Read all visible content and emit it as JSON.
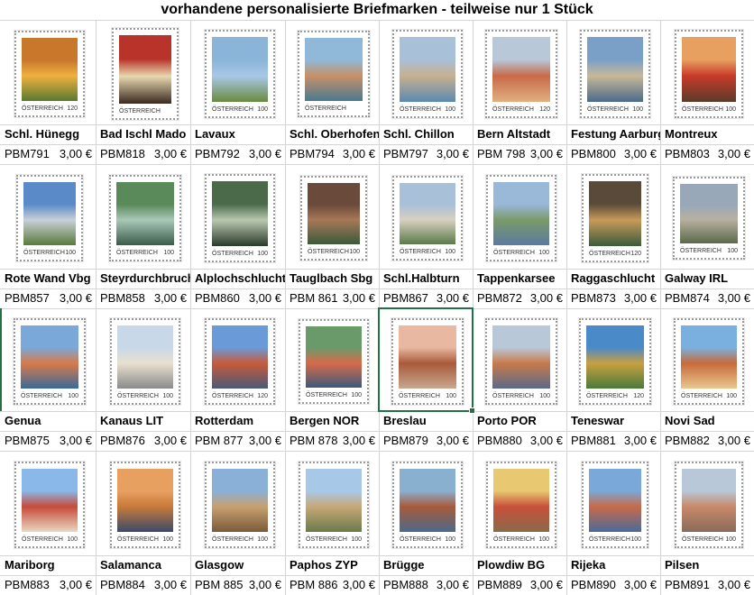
{
  "title": "vorhandene personalisierte Briefmarken -  teilweise nur 1 Stück",
  "stamp_country": "ÖSTERREICH",
  "currency": "€",
  "rows": [
    [
      {
        "name": "Schl. Hünegg",
        "code": "PBM791",
        "price": "3,00 €",
        "value": "120",
        "colors": [
          "#c8782a",
          "#f0b040",
          "#5a7a30"
        ]
      },
      {
        "name": "Bad Ischl Mado",
        "code": "PBM818",
        "price": "3,00 €",
        "value": "",
        "colors": [
          "#b8342a",
          "#e8d8b0",
          "#3a2a20"
        ]
      },
      {
        "name": "Lavaux",
        "code": "PBM792",
        "price": "3,00 €",
        "value": "100",
        "colors": [
          "#8ab4d8",
          "#a8c8e8",
          "#6a8a40"
        ]
      },
      {
        "name": "Schl. Oberhofen",
        "code": "PBM794",
        "price": "3,00 €",
        "value": "",
        "colors": [
          "#90b8d8",
          "#c89068",
          "#4a7a90"
        ]
      },
      {
        "name": "Schl. Chillon",
        "code": "PBM797",
        "price": "3,00 €",
        "value": "100",
        "colors": [
          "#a8c0d8",
          "#c8b090",
          "#5a8ab0"
        ]
      },
      {
        "name": "Bern Altstadt",
        "code": "PBM 798",
        "price": "3,00 €",
        "value": "120",
        "colors": [
          "#b8c8d8",
          "#c86a48",
          "#e0b080"
        ]
      },
      {
        "name": "Festung Aarburg",
        "code": "PBM800",
        "price": "3,00 €",
        "value": "100",
        "colors": [
          "#7aa0c8",
          "#c8b898",
          "#4a6a8a"
        ]
      },
      {
        "name": "Montreux",
        "code": "PBM803",
        "price": "3,00 €",
        "value": "100",
        "colors": [
          "#e8a060",
          "#c83a28",
          "#5a3a2a"
        ]
      }
    ],
    [
      {
        "name": "Rote Wand Vbg",
        "code": "PBM857",
        "price": "3,00 €",
        "value": "100",
        "colors": [
          "#5a8ac8",
          "#c8d0d8",
          "#5a7a3a"
        ]
      },
      {
        "name": "Steyrdurchbruch",
        "code": "PBM858",
        "price": "3,00 €",
        "value": "100",
        "colors": [
          "#5a8a5a",
          "#a8c8b8",
          "#3a5a4a"
        ]
      },
      {
        "name": "Alplochschlucht",
        "code": "PBM860",
        "price": "3,00 €",
        "value": "100",
        "colors": [
          "#4a6a4a",
          "#b8c8b0",
          "#2a3a2a"
        ]
      },
      {
        "name": "Tauglbach Sbg",
        "code": "PBM 861",
        "price": "3,00 €",
        "value": "100",
        "colors": [
          "#6a4a3a",
          "#a87858",
          "#3a5a3a"
        ]
      },
      {
        "name": "Schl.Halbturn",
        "code": "PBM867",
        "price": "3,00 €",
        "value": "100",
        "colors": [
          "#a8c0d8",
          "#d8d0c0",
          "#5a7a4a"
        ]
      },
      {
        "name": "Tappenkarsee",
        "code": "PBM872",
        "price": "3,00 €",
        "value": "100",
        "colors": [
          "#9ab8d8",
          "#7a9a6a",
          "#5a7aa0"
        ]
      },
      {
        "name": "Raggaschlucht",
        "code": "PBM873",
        "price": "3,00 €",
        "value": "120",
        "colors": [
          "#5a4a3a",
          "#c89a5a",
          "#3a5a3a"
        ]
      },
      {
        "name": "Galway IRL",
        "code": "PBM874",
        "price": "3,00 €",
        "value": "100",
        "colors": [
          "#98a8b8",
          "#b8b0a0",
          "#5a6a4a"
        ]
      }
    ],
    [
      {
        "name": "Genua",
        "code": "PBM875",
        "price": "3,00 €",
        "value": "100",
        "colors": [
          "#7aa8d8",
          "#d87a4a",
          "#3a6a9a"
        ]
      },
      {
        "name": "Kanaus LIT",
        "code": "PBM876",
        "price": "3,00 €",
        "value": "100",
        "colors": [
          "#c8d8e8",
          "#e8e0d0",
          "#8a8a8a"
        ]
      },
      {
        "name": "Rotterdam",
        "code": "PBM 877",
        "price": "3,00 €",
        "value": "120",
        "colors": [
          "#6a9ad8",
          "#c85a3a",
          "#4a5a7a"
        ]
      },
      {
        "name": "Bergen  NOR",
        "code": "PBM 878",
        "price": "3,00 €",
        "value": "100",
        "colors": [
          "#6a9a6a",
          "#d86a4a",
          "#3a5a7a"
        ]
      },
      {
        "name": "Breslau",
        "code": "PBM879",
        "price": "3,00 €",
        "value": "100",
        "colors": [
          "#e8b8a0",
          "#a85a3a",
          "#c8a890"
        ]
      },
      {
        "name": "Porto   POR",
        "code": "PBM880",
        "price": "3,00 €",
        "value": "100",
        "colors": [
          "#b8c8d8",
          "#c87a4a",
          "#5a6a8a"
        ]
      },
      {
        "name": "Teneswar",
        "code": "PBM881",
        "price": "3,00 €",
        "value": "120",
        "colors": [
          "#4a8ac8",
          "#c8a040",
          "#4a7a3a"
        ]
      },
      {
        "name": "Novi Sad",
        "code": "PBM882",
        "price": "3,00 €",
        "value": "100",
        "colors": [
          "#7ab0e0",
          "#c86a3a",
          "#e8c890"
        ]
      }
    ],
    [
      {
        "name": "Mariborg",
        "code": "PBM883",
        "price": "3,00 €",
        "value": "100",
        "colors": [
          "#8ab8e8",
          "#c84a3a",
          "#e8d8c0"
        ]
      },
      {
        "name": "Salamanca",
        "code": "PBM884",
        "price": "3,00 €",
        "value": "100",
        "colors": [
          "#e8a060",
          "#c87a3a",
          "#3a4a6a"
        ]
      },
      {
        "name": "Glasgow",
        "code": "PBM 885",
        "price": "3,00 €",
        "value": "100",
        "colors": [
          "#8ab0d8",
          "#c8a070",
          "#7a5a3a"
        ]
      },
      {
        "name": "Paphos  ZYP",
        "code": "PBM 886",
        "price": "3,00 €",
        "value": "100",
        "colors": [
          "#a8c8e8",
          "#c8a878",
          "#6a7a4a"
        ]
      },
      {
        "name": "Brügge",
        "code": "PBM888",
        "price": "3,00 €",
        "value": "100",
        "colors": [
          "#8ab0d0",
          "#a85a3a",
          "#4a6a8a"
        ]
      },
      {
        "name": "Plowdiw   BG",
        "code": "PBM889",
        "price": "3,00 €",
        "value": "100",
        "colors": [
          "#e8c870",
          "#c8503a",
          "#8a6a4a"
        ]
      },
      {
        "name": "Rijeka",
        "code": "PBM890",
        "price": "3,00 €",
        "value": "100",
        "colors": [
          "#7aa8d8",
          "#c86a4a",
          "#4a6a9a"
        ]
      },
      {
        "name": "Pilsen",
        "code": "PBM891",
        "price": "3,00 €",
        "value": "100",
        "colors": [
          "#b8c8d8",
          "#c88a6a",
          "#8a6a5a"
        ]
      }
    ]
  ]
}
